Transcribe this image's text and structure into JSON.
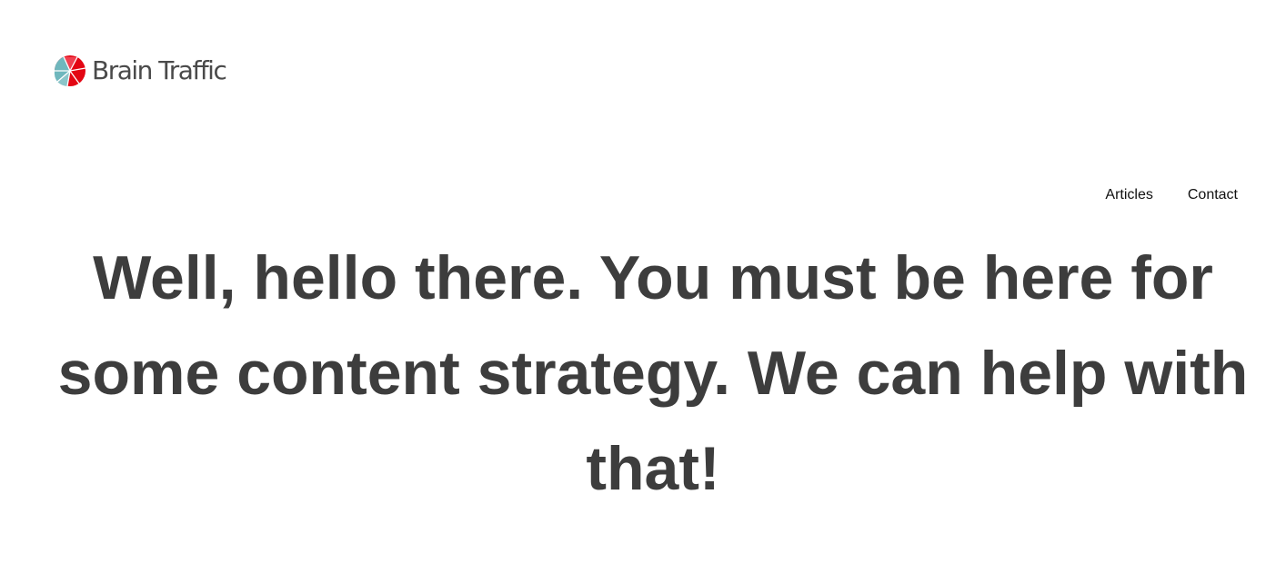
{
  "brand": {
    "name": "Brain Traffic",
    "logo_icon": "brain-traffic-globe-icon",
    "colors": {
      "red": "#e30613",
      "teal": "#6fb7bd",
      "text": "#4a4a4a"
    }
  },
  "nav": {
    "items": [
      {
        "label": "Articles"
      },
      {
        "label": "Contact"
      }
    ]
  },
  "hero": {
    "headline": "Well, hello there. You must be here for some content strategy. We can help with that!",
    "color": "#3d3d3d"
  }
}
